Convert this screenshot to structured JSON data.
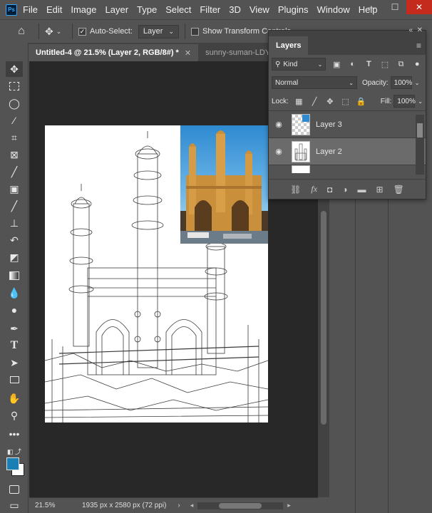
{
  "menubar": {
    "logo": "Ps",
    "items": [
      "File",
      "Edit",
      "Image",
      "Layer",
      "Type",
      "Select",
      "Filter",
      "3D",
      "View",
      "Plugins",
      "Window",
      "Help"
    ],
    "window_controls": [
      "—",
      "☐",
      "✕"
    ]
  },
  "options_bar": {
    "auto_select_label": "Auto-Select:",
    "auto_select_checked": true,
    "auto_select_target": "Layer",
    "transform_controls_label": "Show Transform Controls",
    "transform_controls_checked": false
  },
  "tabs": [
    {
      "label": "Untitled-4 @ 21.5% (Layer 2, RGB/8#) *",
      "close": "✕",
      "active": true
    },
    {
      "label": "sunny-suman-LDYbl",
      "active": false
    }
  ],
  "tools": [
    "move-tool",
    "rectangular-marquee-tool",
    "lasso-tool",
    "magic-wand-tool",
    "crop-tool",
    "frame-tool",
    "eyedropper-tool",
    "spot-healing-tool",
    "brush-tool",
    "clone-stamp-tool",
    "history-brush-tool",
    "eraser-tool",
    "gradient-tool",
    "blur-tool",
    "dodge-tool",
    "pen-tool",
    "type-tool",
    "path-selection-tool",
    "rectangle-tool",
    "hand-tool",
    "zoom-tool",
    "more-tools",
    "default-colors",
    "color-swatches",
    "quick-mask",
    "screen-mode"
  ],
  "colors": {
    "foreground": "#1b7fb6",
    "background": "#ffffff"
  },
  "status": {
    "zoom": "21.5%",
    "doc_size": "1935 px x 2580 px (72 ppi)"
  },
  "layers_panel": {
    "title": "Layers",
    "filter_kind": "Kind",
    "blend_mode": "Normal",
    "opacity_label": "Opacity:",
    "opacity_value": "100%",
    "lock_label": "Lock:",
    "fill_label": "Fill:",
    "fill_value": "100%",
    "layers": [
      {
        "name": "Layer 3",
        "visible": true,
        "selected": false
      },
      {
        "name": "Layer 2",
        "visible": true,
        "selected": true
      },
      {
        "name": "",
        "visible": false,
        "selected": false
      }
    ],
    "footer_icons": [
      "link-icon",
      "fx-icon",
      "mask-icon",
      "adjustment-icon",
      "group-icon",
      "new-layer-icon",
      "trash-icon"
    ]
  }
}
